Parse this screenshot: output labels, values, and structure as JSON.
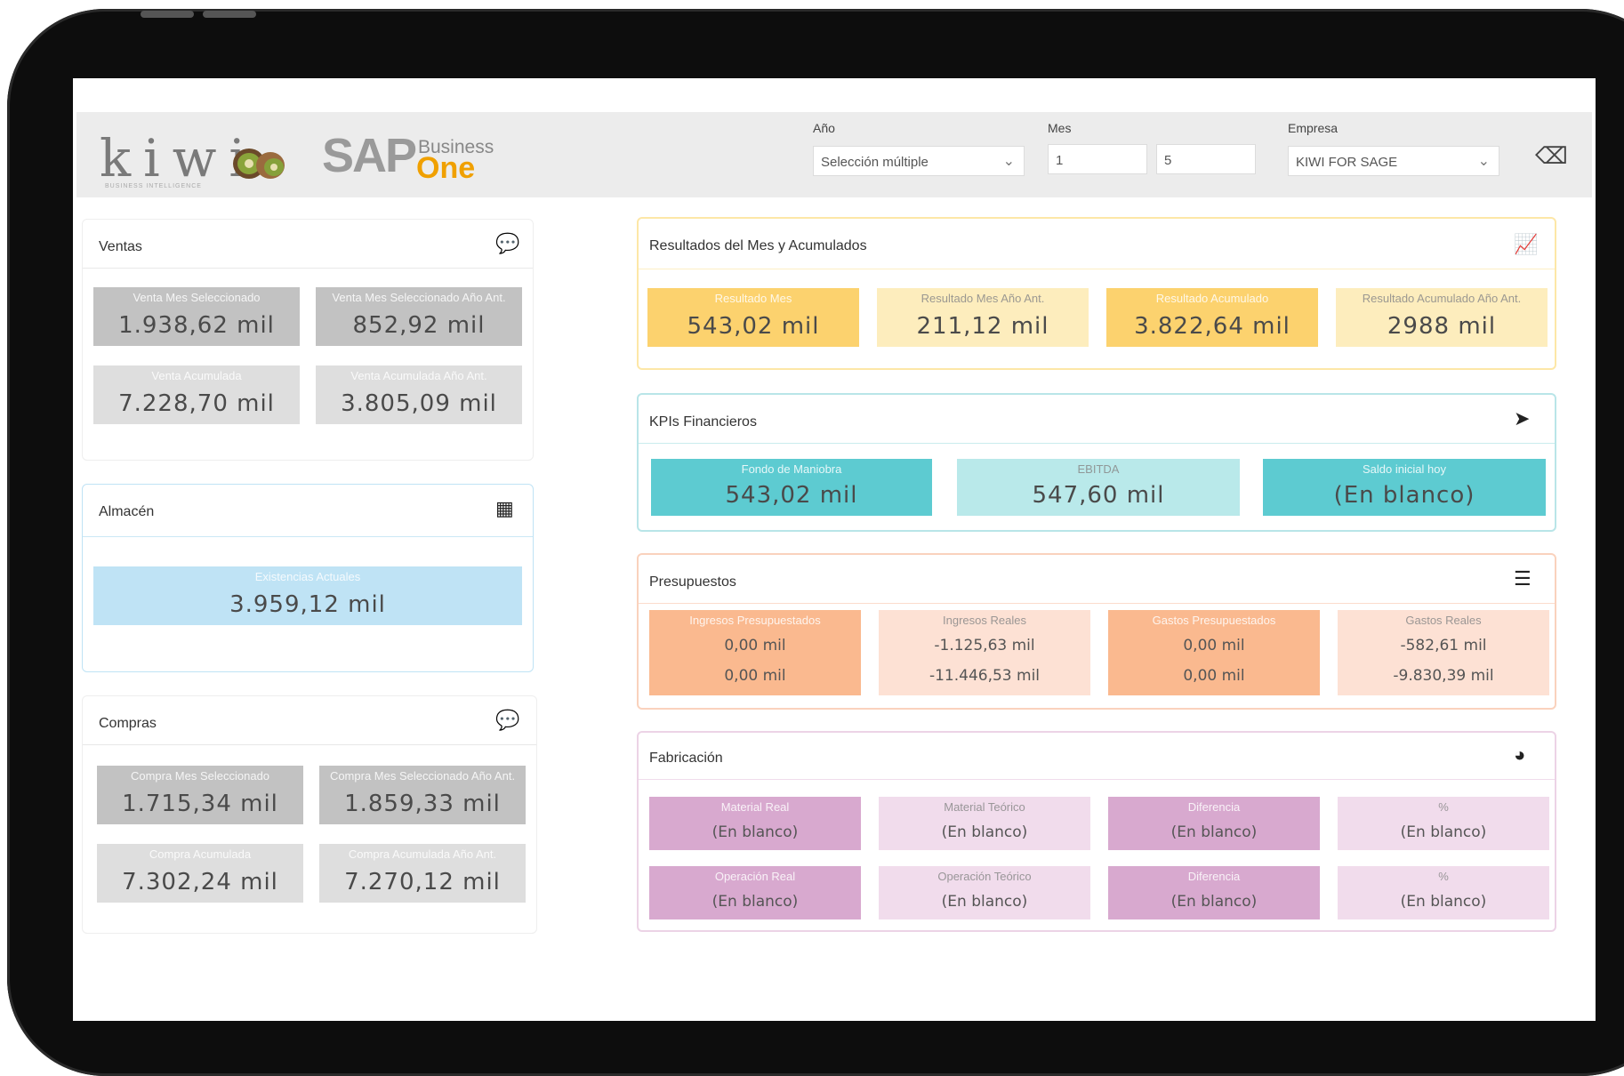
{
  "header": {
    "logo_kiwi": "kiwi",
    "logo_kiwi_sub": "BUSINESS INTELLIGENCE",
    "sap_text": "SAP",
    "sap_business": "Business",
    "sap_one": "One",
    "filters": {
      "anio_label": "Año",
      "anio_value": "Selección múltiple",
      "mes_label": "Mes",
      "mes_from": "1",
      "mes_to": "5",
      "empresa_label": "Empresa",
      "empresa_value": "KIWI FOR SAGE"
    }
  },
  "ventas": {
    "title": "Ventas",
    "tiles": [
      {
        "label": "Venta Mes Seleccionado",
        "value": "1.938,62 mil"
      },
      {
        "label": "Venta Mes Seleccionado Año Ant.",
        "value": "852,92 mil"
      },
      {
        "label": "Venta Acumulada",
        "value": "7.228,70 mil"
      },
      {
        "label": "Venta Acumulada Año Ant.",
        "value": "3.805,09 mil"
      }
    ]
  },
  "almacen": {
    "title": "Almacén",
    "tile": {
      "label": "Existencias Actuales",
      "value": "3.959,12 mil"
    }
  },
  "compras": {
    "title": "Compras",
    "tiles": [
      {
        "label": "Compra Mes Seleccionado",
        "value": "1.715,34 mil"
      },
      {
        "label": "Compra Mes Seleccionado Año Ant.",
        "value": "1.859,33 mil"
      },
      {
        "label": "Compra Acumulada",
        "value": "7.302,24 mil"
      },
      {
        "label": "Compra Acumulada Año Ant.",
        "value": "7.270,12 mil"
      }
    ]
  },
  "resultados": {
    "title": "Resultados del Mes y Acumulados",
    "tiles": [
      {
        "label": "Resultado Mes",
        "value": "543,02 mil"
      },
      {
        "label": "Resultado Mes Año Ant.",
        "value": "211,12 mil"
      },
      {
        "label": "Resultado Acumulado",
        "value": "3.822,64 mil"
      },
      {
        "label": "Resultado Acumulado Año Ant.",
        "value": "2988 mil"
      }
    ]
  },
  "kpis": {
    "title": "KPIs Financieros",
    "tiles": [
      {
        "label": "Fondo de Maniobra",
        "value": "543,02 mil"
      },
      {
        "label": "EBITDA",
        "value": "547,60 mil"
      },
      {
        "label": "Saldo inicial hoy",
        "value": "(En blanco)"
      }
    ]
  },
  "presupuestos": {
    "title": "Presupuestos",
    "tiles": [
      {
        "label": "Ingresos Presupuestados",
        "v1": "0,00 mil",
        "v2": "0,00 mil"
      },
      {
        "label": "Ingresos Reales",
        "v1": "-1.125,63 mil",
        "v2": "-11.446,53 mil"
      },
      {
        "label": "Gastos Presupuestados",
        "v1": "0,00 mil",
        "v2": "0,00 mil"
      },
      {
        "label": "Gastos Reales",
        "v1": "-582,61 mil",
        "v2": "-9.830,39 mil"
      }
    ]
  },
  "fabricacion": {
    "title": "Fabricación",
    "tiles": [
      {
        "label": "Material Real",
        "value": "(En blanco)"
      },
      {
        "label": "Material Teórico",
        "value": "(En blanco)"
      },
      {
        "label": "Diferencia",
        "value": "(En blanco)"
      },
      {
        "label": "%",
        "value": "(En blanco)"
      },
      {
        "label": "Operación Real",
        "value": "(En blanco)"
      },
      {
        "label": "Operación Teórico",
        "value": "(En blanco)"
      },
      {
        "label": "Diferencia",
        "value": "(En blanco)"
      },
      {
        "label": "%",
        "value": "(En blanco)"
      }
    ]
  },
  "colors": {
    "ventas_dark": "#c2c2c2",
    "ventas_light": "#dedede",
    "almacen": "#bfe3f5",
    "resultados_dark": "#fcd26e",
    "resultados_light": "#fdedbd",
    "kpi_dark": "#5dcbd1",
    "kpi_light": "#b9e9ea",
    "presup_dark": "#fab98f",
    "presup_light": "#fde1d4",
    "fab_dark": "#d8a9cf",
    "fab_light": "#f1dcec"
  }
}
